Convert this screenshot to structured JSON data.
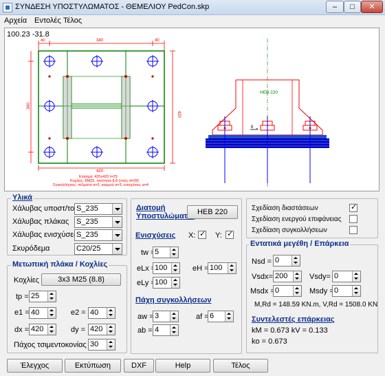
{
  "window": {
    "title": "ΣΥΝΔΕΣΗ ΥΠΟΣΤΥΛΩΜΑΤΟΣ - ΘΕΜΕΛΙΟΥ   PedCon.skp",
    "min": "–",
    "max": "□",
    "close": "✕"
  },
  "menu": {
    "file": "Αρχεία",
    "commands": "Εντολές",
    "end": "Τέλος"
  },
  "drawing": {
    "coords": "100.23 -31.8",
    "note1": "Ελασμα: 420x420  t=25",
    "note2": "Κοχλίες: 8M25, ποιότητα 8.8 (οπές d=28)",
    "note3": "Συγκολλήσεις: πέλματα a=3, κορμού a=3, ενισχύσεις a=4",
    "section": "HEB 220",
    "dim_top1": "40",
    "dim_top2": "340",
    "dim_top3": "40",
    "dim_left": "340",
    "dim_right": "420",
    "dim_bottom": "420",
    "dim_e": "6",
    "colors": {
      "plate": "#008000",
      "bolt": "#0000ff",
      "column": "#ff0000",
      "weld": "#ff0000"
    }
  },
  "materials": {
    "legend": "Υλικά",
    "steel_column_label": "Χάλυβας υποστ/τος",
    "steel_column_value": "S_235",
    "steel_plate_label": "Χάλυβας πλάκας",
    "steel_plate_value": "S_235",
    "steel_stiff_label": "Χάλυβας ενισχύσεων",
    "steel_stiff_value": "S_235",
    "concrete_label": "Σκυρόδεμα",
    "concrete_value": "C20/25"
  },
  "plate": {
    "legend": "Μετωπική πλάκα / Κοχλίες",
    "bolts_label": "Κοχλίες",
    "bolts_button": "3x3 M25 (8.8)",
    "tp_label": "tp =",
    "tp_value": "25",
    "e1_label": "e1 =",
    "e1_value": "40",
    "e2_label": "e2 =",
    "e2_value": "40",
    "dx_label": "dx =",
    "dx_value": "420",
    "dy_label": "dy =",
    "dy_value": "420",
    "grout_label": "Πάχος τσιμεντοκονίας =",
    "grout_value": "30"
  },
  "column": {
    "section_label_line1": "Διατομή",
    "section_label_line2": "Υποστυλώματος",
    "section_button": "HEB 220",
    "stiff_label": "Ενισχύσεις",
    "x_label": "X:",
    "y_label": "Y:",
    "tw_label": "tw =",
    "tw_value": "5",
    "elx_label": "eLx =",
    "elx_value": "100",
    "eh_label": "eH =",
    "eh_value": "100",
    "ely_label": "eLy =",
    "ely_value": "100",
    "welds_label": "Πάχη συγκολλήσεων",
    "aw_label": "aw =",
    "aw_value": "3",
    "af_label": "af =",
    "af_value": "6",
    "ab_label": "ab =",
    "ab_value": "4"
  },
  "options": {
    "dims_label": "Σχεδίαση διαστάσεων",
    "active_label": "Σχεδίαση ενεργού επιφάνειας",
    "welds_label": "Σχεδίαση συγκολλήσεων"
  },
  "forces": {
    "legend": "Εντατικά μεγέθη / Επάρκεια",
    "nsd_label": "Nsd =",
    "nsd_value": "0",
    "vsdx_label": "Vsdx=",
    "vsdx_value": "200",
    "vsdy_label": "Vsdy=",
    "vsdy_value": "0",
    "msdx_label": "Msdx =",
    "msdx_value": "0",
    "msdy_label": "Msdy =",
    "msdy_value": "0",
    "resist": "M,Rd = 148.59 KN.m,   V,Rd = 1508.0 KN",
    "coef_title": "Συντελεστές επάρκειας",
    "km": "kM = 0.673  kV = 0.133",
    "ko": "ko = 0.673"
  },
  "buttons": {
    "check": "Έλεγχος",
    "print": "Εκτύπωση",
    "dxf": "DXF",
    "help": "Help",
    "end": "Τέλος"
  }
}
